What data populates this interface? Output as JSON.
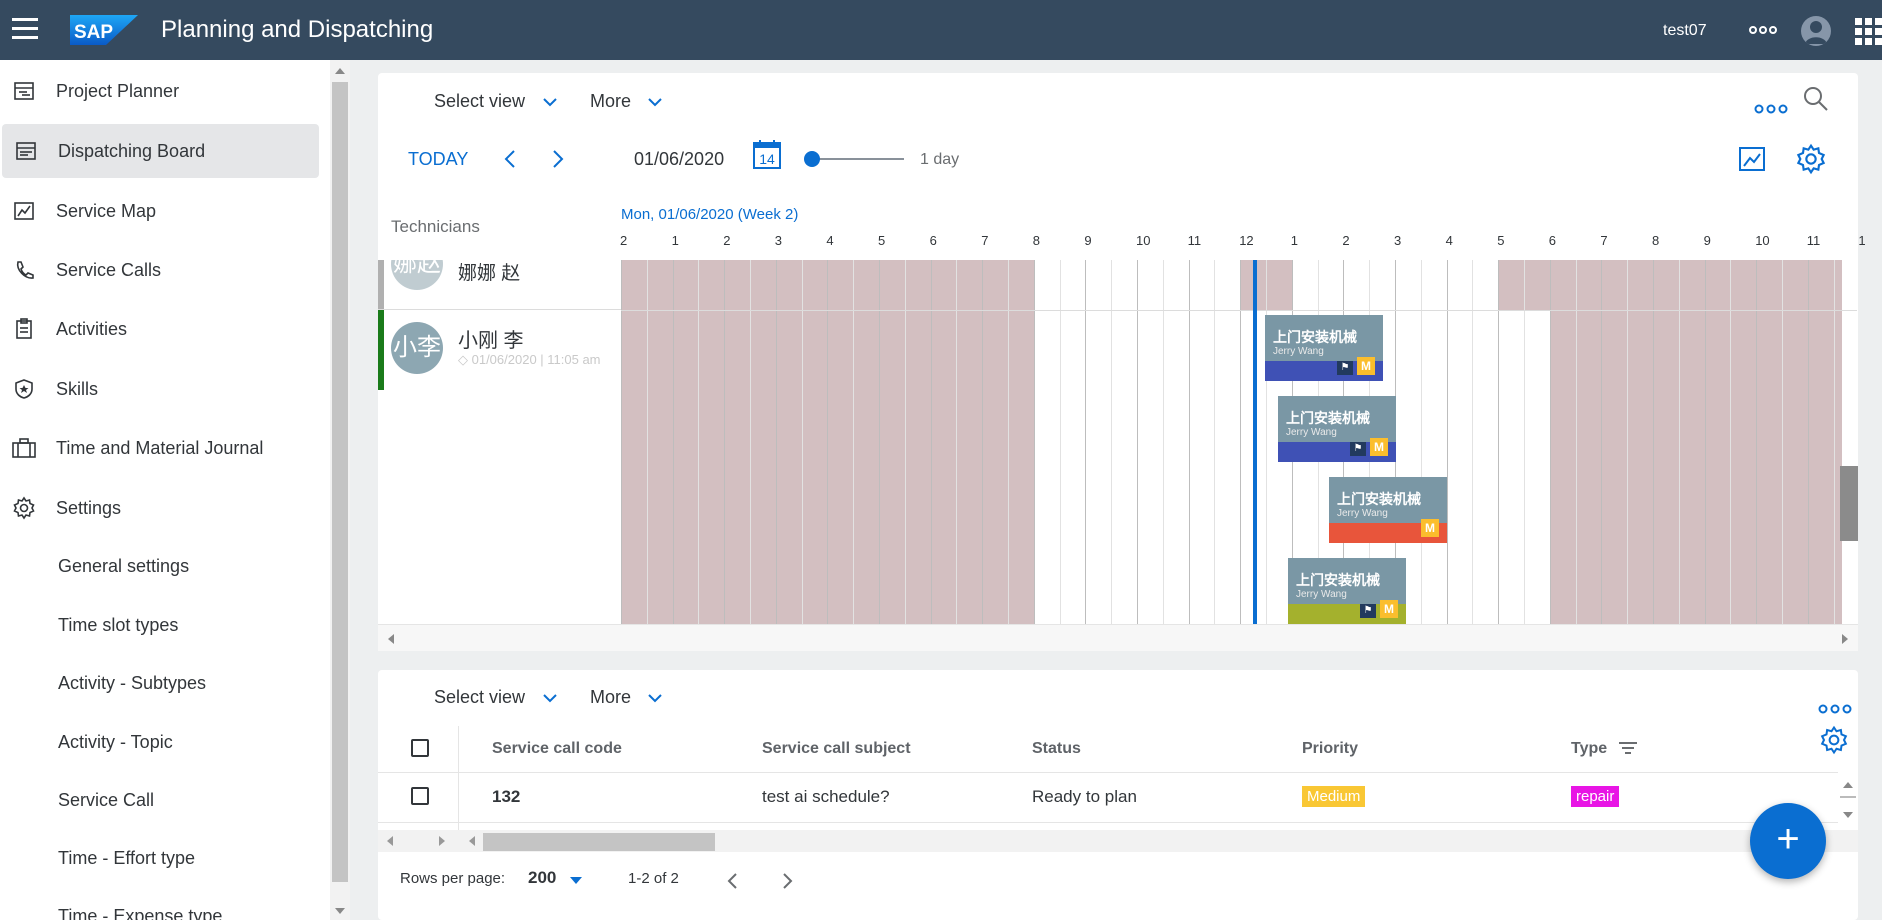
{
  "shell": {
    "app_title": "Planning and Dispatching",
    "user_name": "test07",
    "logo_text": "SAP"
  },
  "sidenav": {
    "items": [
      {
        "label": "Project Planner",
        "icon": "project-planner-icon"
      },
      {
        "label": "Dispatching Board",
        "icon": "dispatching-board-icon",
        "selected": true
      },
      {
        "label": "Service Map",
        "icon": "map-icon"
      },
      {
        "label": "Service Calls",
        "icon": "phone-icon"
      },
      {
        "label": "Activities",
        "icon": "clipboard-icon"
      },
      {
        "label": "Skills",
        "icon": "badge-icon"
      },
      {
        "label": "Time and Material Journal",
        "icon": "briefcase-icon"
      },
      {
        "label": "Settings",
        "icon": "gear-icon"
      }
    ],
    "subitems": [
      "General settings",
      "Time slot types",
      "Activity - Subtypes",
      "Activity - Topic",
      "Service Call",
      "Time - Effort type",
      "Time - Expense type"
    ]
  },
  "planner": {
    "select_view": "Select view",
    "more": "More",
    "today": "TODAY",
    "date": "01/06/2020",
    "calendar_day": "14",
    "zoom_label": "1 day",
    "technicians_header": "Technicians",
    "week_label": "Mon, 01/06/2020 (Week 2)",
    "hours": [
      "2",
      "1",
      "2",
      "3",
      "4",
      "5",
      "6",
      "7",
      "8",
      "9",
      "10",
      "11",
      "12",
      "1",
      "2",
      "3",
      "4",
      "5",
      "6",
      "7",
      "8",
      "9",
      "10",
      "11",
      "1"
    ],
    "technicians": [
      {
        "avatar": "娜赵",
        "name": "娜娜 赵",
        "sub": ""
      },
      {
        "avatar": "小李",
        "name": "小刚 李",
        "sub": "01/06/2020 | 11:05 am"
      }
    ],
    "tasks": [
      {
        "title": "上门安装机械",
        "person": "Jerry Wang",
        "bar_color": "#3f51b5",
        "flag": true,
        "badge": "M"
      },
      {
        "title": "上门安装机械",
        "person": "Jerry Wang",
        "bar_color": "#3f51b5",
        "flag": true,
        "badge": "M"
      },
      {
        "title": "上门安装机械",
        "person": "Jerry Wang",
        "bar_color": "#e8553b",
        "flag": false,
        "badge": "M"
      },
      {
        "title": "上门安装机械",
        "person": "Jerry Wang",
        "bar_color": "#a4b12d",
        "flag": true,
        "badge": "M"
      }
    ]
  },
  "table": {
    "select_view": "Select view",
    "more": "More",
    "columns": [
      "Service call code",
      "Service call subject",
      "Status",
      "Priority",
      "Type"
    ],
    "rows": [
      {
        "code": "132",
        "subject": "test ai schedule?",
        "status": "Ready to plan",
        "priority": "Medium",
        "type": "repair"
      }
    ],
    "rows_per_page_label": "Rows per page:",
    "rows_per_page": "200",
    "range": "1-2 of 2"
  },
  "colors": {
    "shell": "#354a5f",
    "accent": "#0a6ed1",
    "unavailable": "#d3bfc1",
    "priority_medium": "#f9c734",
    "type_repair": "#e815e5"
  }
}
